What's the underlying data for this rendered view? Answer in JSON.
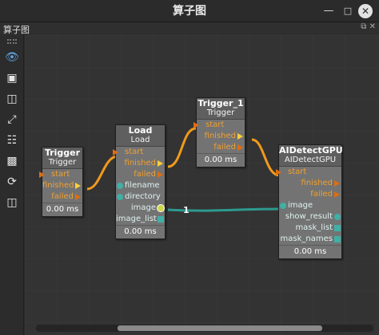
{
  "window": {
    "title": "算子图",
    "minimize_icon": "minimize-icon",
    "maximize_icon": "maximize-icon",
    "close_icon": "close-icon"
  },
  "panel": {
    "title": "算子图",
    "float_icon": "float-panel-icon",
    "close_icon": "close-panel-icon"
  },
  "toolbar": [
    {
      "name": "view-eye-tool",
      "icon": "eye-icon"
    },
    {
      "name": "fit-view-tool",
      "icon": "fit-frame-icon"
    },
    {
      "name": "node-layout-tool",
      "icon": "nodes-icon"
    },
    {
      "name": "arrange-tool",
      "icon": "arrange-icon"
    },
    {
      "name": "hierarchy-tool",
      "icon": "hierarchy-icon"
    },
    {
      "name": "image-tool",
      "icon": "image-icon"
    },
    {
      "name": "refresh-tool",
      "icon": "refresh-icon"
    },
    {
      "name": "screen-tool",
      "icon": "screen-icon"
    }
  ],
  "nodes": {
    "trigger": {
      "title": "Trigger",
      "type": "Trigger",
      "inputs": [
        "start"
      ],
      "outputs": [
        "finished",
        "failed"
      ],
      "time": "0.00 ms"
    },
    "load": {
      "title": "Load",
      "type": "Load",
      "inputs": [
        "start",
        "filename",
        "directory"
      ],
      "outputs": [
        "finished",
        "failed",
        "image",
        "image_list"
      ],
      "time": "0.00 ms"
    },
    "trigger_1": {
      "title": "Trigger_1",
      "type": "Trigger",
      "inputs": [
        "start"
      ],
      "outputs": [
        "finished",
        "failed"
      ],
      "time": "0.00 ms"
    },
    "aidetect": {
      "title": "AIDetectGPU",
      "type": "AIDetectGPU",
      "inputs": [
        "start",
        "image"
      ],
      "outputs": [
        "finished",
        "failed",
        "show_result",
        "mask_list",
        "mask_names"
      ],
      "time": "0.00 ms"
    }
  },
  "edges": {
    "image_link_label": "1"
  },
  "colors": {
    "exec_wire": "#f09a1c",
    "data_wire": "#2d9a8f",
    "exec_pin": "#e06d10",
    "data_pin": "#3fb0a6"
  }
}
